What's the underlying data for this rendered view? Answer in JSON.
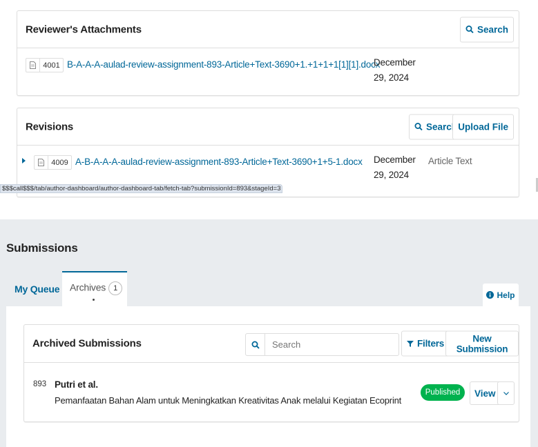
{
  "reviewer_attachments": {
    "title": "Reviewer's Attachments",
    "search_label": "Search",
    "files": [
      {
        "id": "4001",
        "name": "B-A-A-A-aulad-review-assignment-893-Article+Text-3690+1.+1+1+1[1][1].docx",
        "date_line1": "December",
        "date_line2": "29, 2024"
      }
    ]
  },
  "revisions": {
    "title": "Revisions",
    "search_label": "Search",
    "upload_label": "Upload File",
    "files": [
      {
        "id": "4009",
        "name": "A-B-A-A-A-aulad-review-assignment-893-Article+Text-3690+1+5-1.docx",
        "date_line1": "December",
        "date_line2": "29, 2024",
        "genre": "Article Text"
      }
    ]
  },
  "status_bar_url": "$$$call$$$/tab/author-dashboard/author-dashboard-tab/fetch-tab?submissionId=893&stageId=3",
  "submissions": {
    "page_title": "Submissions",
    "tabs": {
      "my_queue": "My Queue",
      "archives": "Archives",
      "archives_count": "1"
    },
    "help_label": "Help",
    "list": {
      "title": "Archived Submissions",
      "search_placeholder": "Search",
      "filters_label": "Filters",
      "new_submission_label": "New Submission",
      "items": [
        {
          "id": "893",
          "authors": "Putri et al.",
          "title": "Pemanfaatan Bahan Alam untuk Meningkatkan Kreativitas Anak melalui Kegiatan Ecoprint",
          "status": "Published",
          "view_label": "View"
        }
      ]
    }
  },
  "colors": {
    "link": "#006798",
    "published": "#00b24e",
    "panel_bg": "#e9ecef",
    "border": "#dddddd"
  },
  "icons": [
    "search-icon",
    "filter-icon",
    "info-icon",
    "file-doc-icon",
    "caret-right-icon",
    "chevron-down-icon"
  ]
}
